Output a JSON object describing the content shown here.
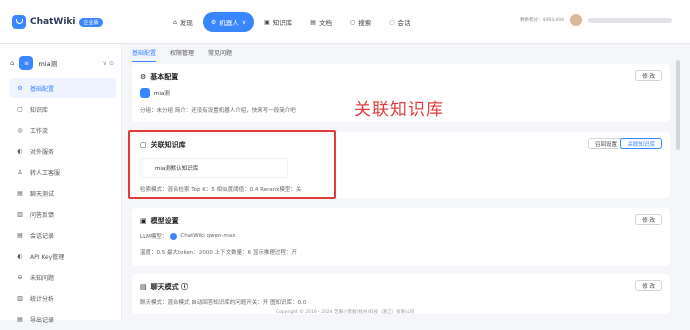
{
  "app": {
    "name": "ChatWiki",
    "edition_badge": "企业版"
  },
  "nav": [
    {
      "label": "发现",
      "icon": "⌂"
    },
    {
      "label": "机器人",
      "icon": "⚙",
      "active": true,
      "chevron": "∨"
    },
    {
      "label": "知识库",
      "icon": "▣"
    },
    {
      "label": "文档",
      "icon": "▤"
    },
    {
      "label": "搜索",
      "icon": "○"
    },
    {
      "label": "会话",
      "icon": "◌"
    }
  ],
  "top_right": {
    "info": "剩余积分：4493,444"
  },
  "sidebar": {
    "bot_name": "mia测",
    "bot_initial": "≡",
    "bot_controls": "∨ ⊙",
    "items": [
      {
        "label": "基础配置",
        "icon": "⚙",
        "active": true
      },
      {
        "label": "知识库",
        "icon": "▢"
      },
      {
        "label": "工作流",
        "icon": "◎"
      },
      {
        "label": "对外服务",
        "icon": "◐"
      },
      {
        "label": "转人工客服",
        "icon": "♙"
      },
      {
        "label": "聊天测试",
        "icon": "▤"
      },
      {
        "label": "问答反馈",
        "icon": "▥"
      },
      {
        "label": "会话记录",
        "icon": "▤"
      },
      {
        "label": "API Key管理",
        "icon": "◐"
      },
      {
        "label": "未知问题",
        "icon": "⊖"
      },
      {
        "label": "统计分析",
        "icon": "▥"
      },
      {
        "label": "导出记录",
        "icon": "▤"
      }
    ]
  },
  "tabs": [
    "基础配置",
    "权限管理",
    "常见问题"
  ],
  "basic": {
    "title": "基本配置",
    "edit": "修 改",
    "bot_name": "mia测",
    "desc": "分组：未分组   简介：还没有设置机器人介绍，快来写一段简介吧"
  },
  "kb": {
    "title": "关联知识库",
    "recall": "召回设置",
    "link": "关联知识库",
    "item": "mia测默认知识库",
    "summary": "检索模式：混合检索   Top K：5   相似度阈值：0.4   Rerank模型：关"
  },
  "model": {
    "title": "模型设置",
    "edit": "修 改",
    "model_line_prefix": "LLM模型：",
    "model_name": "ChatWiki qwen-max",
    "params": "温度：0.5   最大token：2000   上下文数量：6   显示推理过程：开"
  },
  "chat": {
    "title": "聊天模式 ⓘ",
    "edit": "修 改",
    "line": "聊天模式：混合模式   自动回答知识库的问题开关：开   图知识库：0.0"
  },
  "annotation": "关联知识库",
  "footer": "Copyright © 2016 - 2024 芝麻小客服(杭州)科技（浙江）有限公司"
}
